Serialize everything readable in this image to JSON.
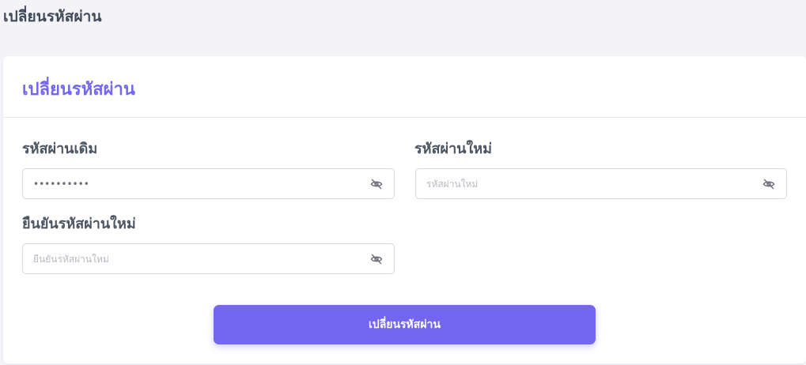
{
  "page": {
    "heading": "เปลี่ยนรหัสผ่าน"
  },
  "card": {
    "title": "เปลี่ยนรหัสผ่าน"
  },
  "form": {
    "old_password": {
      "label": "รหัสผ่านเดิม",
      "value": "••••••••••",
      "placeholder": ""
    },
    "new_password": {
      "label": "รหัสผ่านใหม่",
      "value": "",
      "placeholder": "รหัสผ่านใหม่"
    },
    "confirm_password": {
      "label": "ยืนยันรหัสผ่านใหม่",
      "value": "",
      "placeholder": "ยืนยันรหัสผ่านใหม่"
    },
    "submit_label": "เปลี่ยนรหัสผ่าน"
  },
  "colors": {
    "accent": "#7367f0",
    "background": "#f3f3f8",
    "text": "#4b5563"
  },
  "icons": {
    "toggle_visibility": "eye-off-icon"
  }
}
